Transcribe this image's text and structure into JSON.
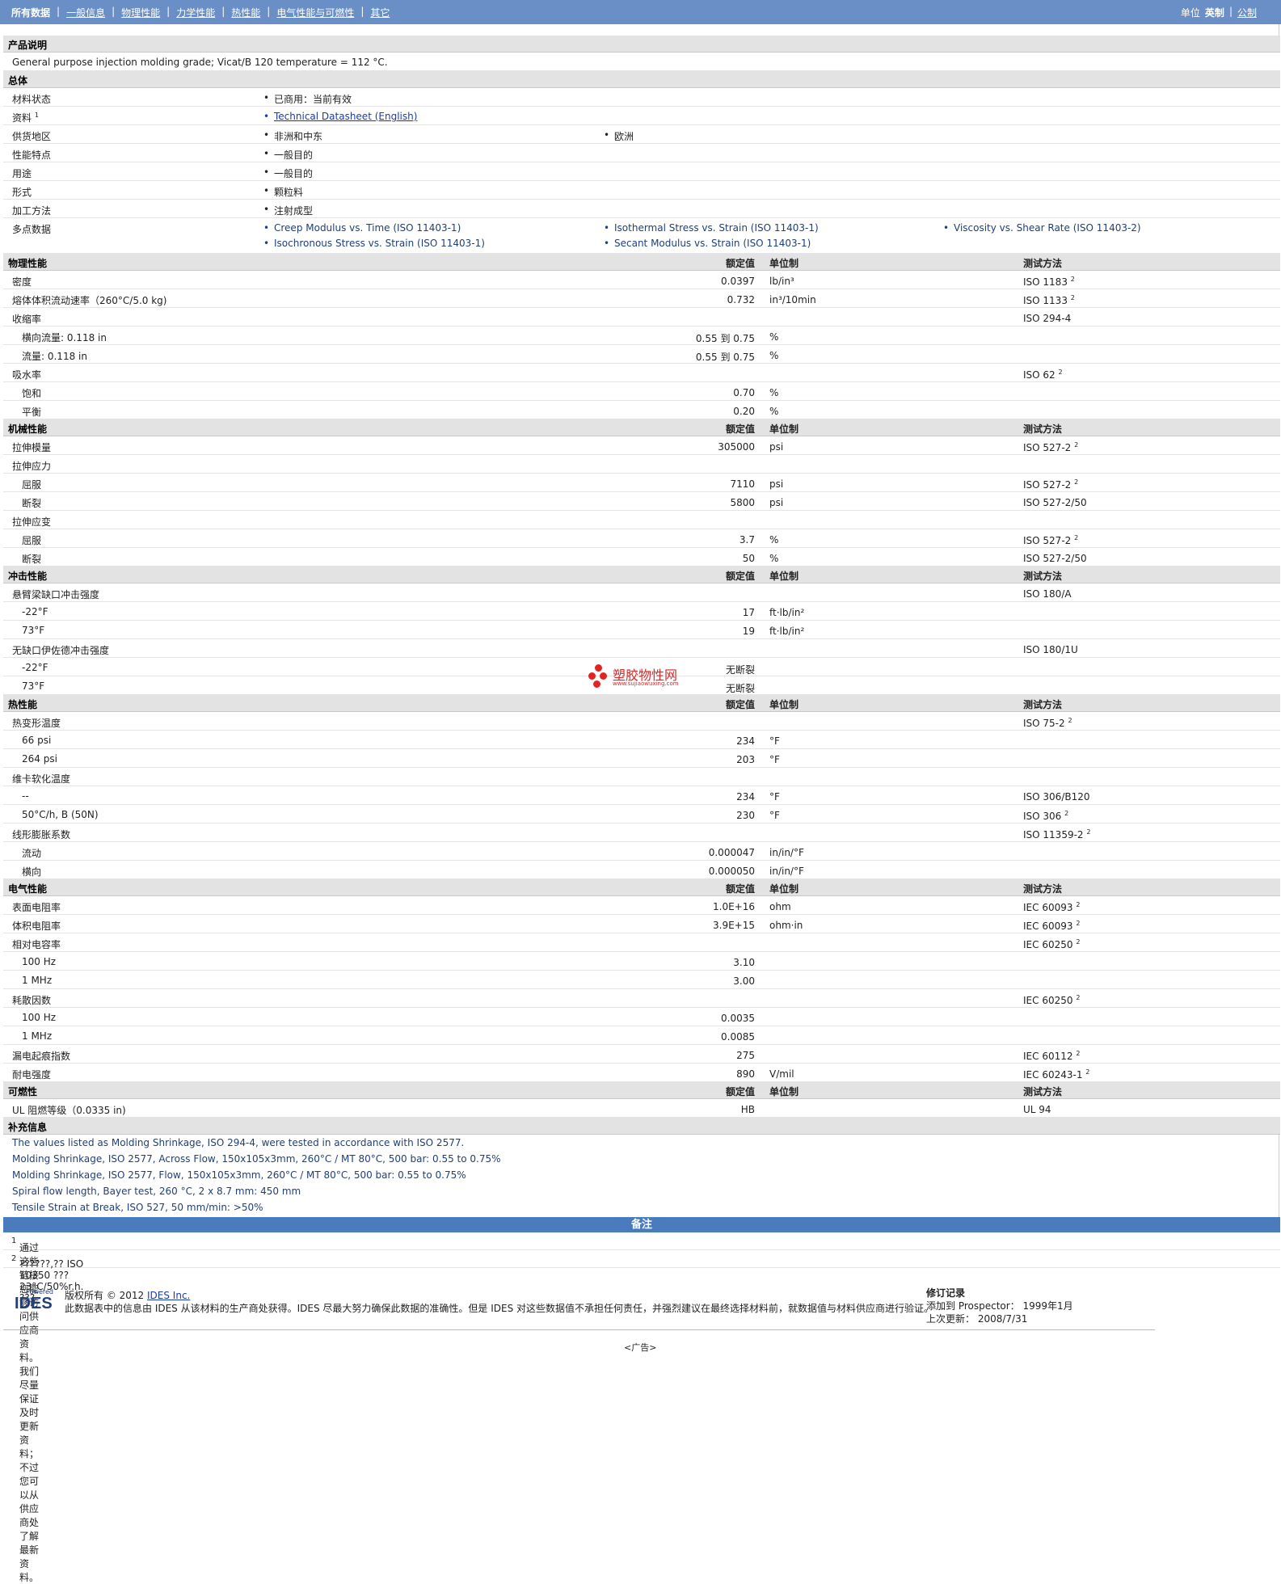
{
  "nav": {
    "tabs": [
      "所有数据",
      "一般信息",
      "物理性能",
      "力学性能",
      "热性能",
      "电气性能与可燃性",
      "其它"
    ],
    "units_label": "单位",
    "unit_english": "英制",
    "unit_metric": "公制"
  },
  "product_desc": {
    "title": "产品说明",
    "text": "General purpose injection molding grade; Vicat/B 120 temperature = 112 °C."
  },
  "general": {
    "title": "总体",
    "rows": [
      {
        "label": "材料状态",
        "items": [
          "已商用：当前有效"
        ]
      },
      {
        "label": "资料",
        "sup": "1",
        "items": [
          "Technical Datasheet (English)"
        ]
      },
      {
        "label": "供货地区",
        "items": [
          "非洲和中东",
          "欧洲"
        ]
      },
      {
        "label": "性能特点",
        "items": [
          "一般目的"
        ]
      },
      {
        "label": "用途",
        "items": [
          "一般目的"
        ]
      },
      {
        "label": "形式",
        "items": [
          "颗粒料"
        ]
      },
      {
        "label": "加工方法",
        "items": [
          "注射成型"
        ]
      },
      {
        "label": "多点数据",
        "items": [
          "Creep Modulus vs. Time (ISO 11403-1)",
          "Isothermal Stress vs. Strain (ISO 11403-1)",
          "Viscosity vs. Shear Rate (ISO 11403-2)",
          "Isochronous Stress vs. Strain (ISO 11403-1)",
          "Secant Modulus vs. Strain (ISO 11403-1)"
        ]
      }
    ]
  },
  "headers": {
    "value": "额定值",
    "unit": "单位制",
    "test": "测试方法"
  },
  "physical": {
    "title": "物理性能",
    "rows": [
      {
        "label": "密度",
        "val": "0.0397",
        "unit": "lb/in³",
        "test": "ISO 1183",
        "sup": "2"
      },
      {
        "label": "熔体体积流动速率（260°C/5.0 kg)",
        "val": "0.732",
        "unit": "in³/10min",
        "test": "ISO 1133",
        "sup": "2"
      },
      {
        "label": "收缩率",
        "val": "",
        "unit": "",
        "test": "ISO 294-4",
        "sup": ""
      },
      {
        "label": "横向流量: 0.118 in",
        "sub": true,
        "val": "0.55 到  0.75",
        "unit": "%",
        "test": "",
        "sup": ""
      },
      {
        "label": "流量: 0.118 in",
        "sub": true,
        "val": "0.55 到  0.75",
        "unit": "%",
        "test": "",
        "sup": ""
      },
      {
        "label": "吸水率",
        "val": "",
        "unit": "",
        "test": "ISO 62",
        "sup": "2"
      },
      {
        "label": "饱和",
        "sub": true,
        "val": "0.70",
        "unit": "%",
        "test": "",
        "sup": ""
      },
      {
        "label": "平衡",
        "sub": true,
        "val": "0.20",
        "unit": "%",
        "test": "",
        "sup": ""
      }
    ]
  },
  "mechanical": {
    "title": "机械性能",
    "rows": [
      {
        "label": "拉伸模量",
        "val": "305000",
        "unit": "psi",
        "test": "ISO 527-2",
        "sup": "2"
      },
      {
        "label": "拉伸应力",
        "val": "",
        "unit": "",
        "test": "",
        "sup": ""
      },
      {
        "label": "屈服",
        "sub": true,
        "val": "7110",
        "unit": "psi",
        "test": "ISO 527-2",
        "sup": "2"
      },
      {
        "label": "断裂",
        "sub": true,
        "val": "5800",
        "unit": "psi",
        "test": "ISO 527-2/50",
        "sup": ""
      },
      {
        "label": "拉伸应变",
        "val": "",
        "unit": "",
        "test": "",
        "sup": ""
      },
      {
        "label": "屈服",
        "sub": true,
        "val": "3.7",
        "unit": "%",
        "test": "ISO 527-2",
        "sup": "2"
      },
      {
        "label": "断裂",
        "sub": true,
        "val": "50",
        "unit": "%",
        "test": "ISO 527-2/50",
        "sup": ""
      }
    ]
  },
  "impact": {
    "title": "冲击性能",
    "rows": [
      {
        "label": "悬臂梁缺口冲击强度",
        "val": "",
        "unit": "",
        "test": "ISO 180/A",
        "sup": ""
      },
      {
        "label": "-22°F",
        "sub": true,
        "val": "17",
        "unit": "ft·lb/in²",
        "test": "",
        "sup": ""
      },
      {
        "label": "73°F",
        "sub": true,
        "val": "19",
        "unit": "ft·lb/in²",
        "test": "",
        "sup": ""
      },
      {
        "label": "无缺口伊佐德冲击强度",
        "val": "",
        "unit": "",
        "test": "ISO 180/1U",
        "sup": ""
      },
      {
        "label": "-22°F",
        "sub": true,
        "val": "无断裂",
        "unit": "",
        "test": "",
        "sup": ""
      },
      {
        "label": "73°F",
        "sub": true,
        "val": "无断裂",
        "unit": "",
        "test": "",
        "sup": ""
      }
    ]
  },
  "thermal": {
    "title": "热性能",
    "rows": [
      {
        "label": "热变形温度",
        "val": "",
        "unit": "",
        "test": "ISO 75-2",
        "sup": "2"
      },
      {
        "label": "66 psi",
        "sub": true,
        "val": "234",
        "unit": "°F",
        "test": "",
        "sup": ""
      },
      {
        "label": "264 psi",
        "sub": true,
        "val": "203",
        "unit": "°F",
        "test": "",
        "sup": ""
      },
      {
        "label": "维卡软化温度",
        "val": "",
        "unit": "",
        "test": "",
        "sup": ""
      },
      {
        "label": "--",
        "sub": true,
        "val": "234",
        "unit": "°F",
        "test": "ISO 306/B120",
        "sup": ""
      },
      {
        "label": "50°C/h, B (50N)",
        "sub": true,
        "val": "230",
        "unit": "°F",
        "test": "ISO 306",
        "sup": "2"
      },
      {
        "label": "线形膨胀系数",
        "val": "",
        "unit": "",
        "test": "ISO 11359-2",
        "sup": "2"
      },
      {
        "label": "流动",
        "sub": true,
        "val": "0.000047",
        "unit": "in/in/°F",
        "test": "",
        "sup": ""
      },
      {
        "label": "横向",
        "sub": true,
        "val": "0.000050",
        "unit": "in/in/°F",
        "test": "",
        "sup": ""
      }
    ]
  },
  "electrical": {
    "title": "电气性能",
    "rows": [
      {
        "label": "表面电阻率",
        "val": "1.0E+16",
        "unit": "ohm",
        "test": "IEC 60093",
        "sup": "2"
      },
      {
        "label": "体积电阻率",
        "val": "3.9E+15",
        "unit": "ohm·in",
        "test": "IEC 60093",
        "sup": "2"
      },
      {
        "label": "相对电容率",
        "val": "",
        "unit": "",
        "test": "IEC 60250",
        "sup": "2"
      },
      {
        "label": "100 Hz",
        "sub": true,
        "val": "3.10",
        "unit": "",
        "test": "",
        "sup": ""
      },
      {
        "label": "1 MHz",
        "sub": true,
        "val": "3.00",
        "unit": "",
        "test": "",
        "sup": ""
      },
      {
        "label": "耗散因数",
        "val": "",
        "unit": "",
        "test": "IEC 60250",
        "sup": "2"
      },
      {
        "label": "100 Hz",
        "sub": true,
        "val": "0.0035",
        "unit": "",
        "test": "",
        "sup": ""
      },
      {
        "label": "1 MHz",
        "sub": true,
        "val": "0.0085",
        "unit": "",
        "test": "",
        "sup": ""
      },
      {
        "label": "漏电起痕指数",
        "val": "275",
        "unit": "",
        "test": "IEC 60112",
        "sup": "2"
      },
      {
        "label": "耐电强度",
        "val": "890",
        "unit": "V/mil",
        "test": "IEC 60243-1",
        "sup": "2"
      }
    ]
  },
  "flammability": {
    "title": "可燃性",
    "rows": [
      {
        "label": "UL 阻燃等级（0.0335 in)",
        "val": "HB",
        "unit": "",
        "test": "UL 94",
        "sup": ""
      }
    ]
  },
  "supplemental": {
    "title": "补充信息",
    "lines": [
      "The values listed as Molding Shrinkage, ISO 294-4, were tested in accordance with ISO 2577.",
      "Molding Shrinkage, ISO 2577, Across Flow, 150x105x3mm, 260°C / MT 80°C, 500 bar: 0.55 to 0.75%",
      "Molding Shrinkage, ISO 2577, Flow, 150x105x3mm, 260°C / MT 80°C, 500 bar: 0.55 to 0.75%",
      "Spiral flow length, Bayer test, 260 °C, 2 x 8.7 mm: 450 mm",
      "Tensile Strain at Break, ISO 527, 50 mm/min: >50%"
    ]
  },
  "notes": {
    "title": "备注",
    "items": [
      {
        "sup": "1",
        "text": "通过这些链接您能够访问供应商资料。我们尽量保证及时更新资料；不过您可以从供应商处了解最新资料。"
      },
      {
        "sup": "2",
        "text": "??????,?? ISO 10350 ??? 23°C/50%r.h. ???"
      }
    ]
  },
  "footer": {
    "powered_by": "Powered by",
    "logo": "IDES",
    "copyright_prefix": "版权所有 © 2012",
    "copyright_link": "IDES Inc.",
    "disclaimer": "此数据表中的信息由 IDES 从该材料的生产商处获得。IDES 尽最大努力确保此数据的准确性。但是 IDES 对这些数据值不承担任何责任，并强烈建议在最终选择材料前，就数据值与材料供应商进行验证。",
    "rev_title": "修订记录",
    "rev_added": "添加到 Prospector： 1999年1月",
    "rev_updated": "上次更新： 2008/7/31",
    "ad": "<广告>"
  },
  "watermark": {
    "name": "塑胶物性网",
    "url": "www.sujiaowuxing.com"
  }
}
